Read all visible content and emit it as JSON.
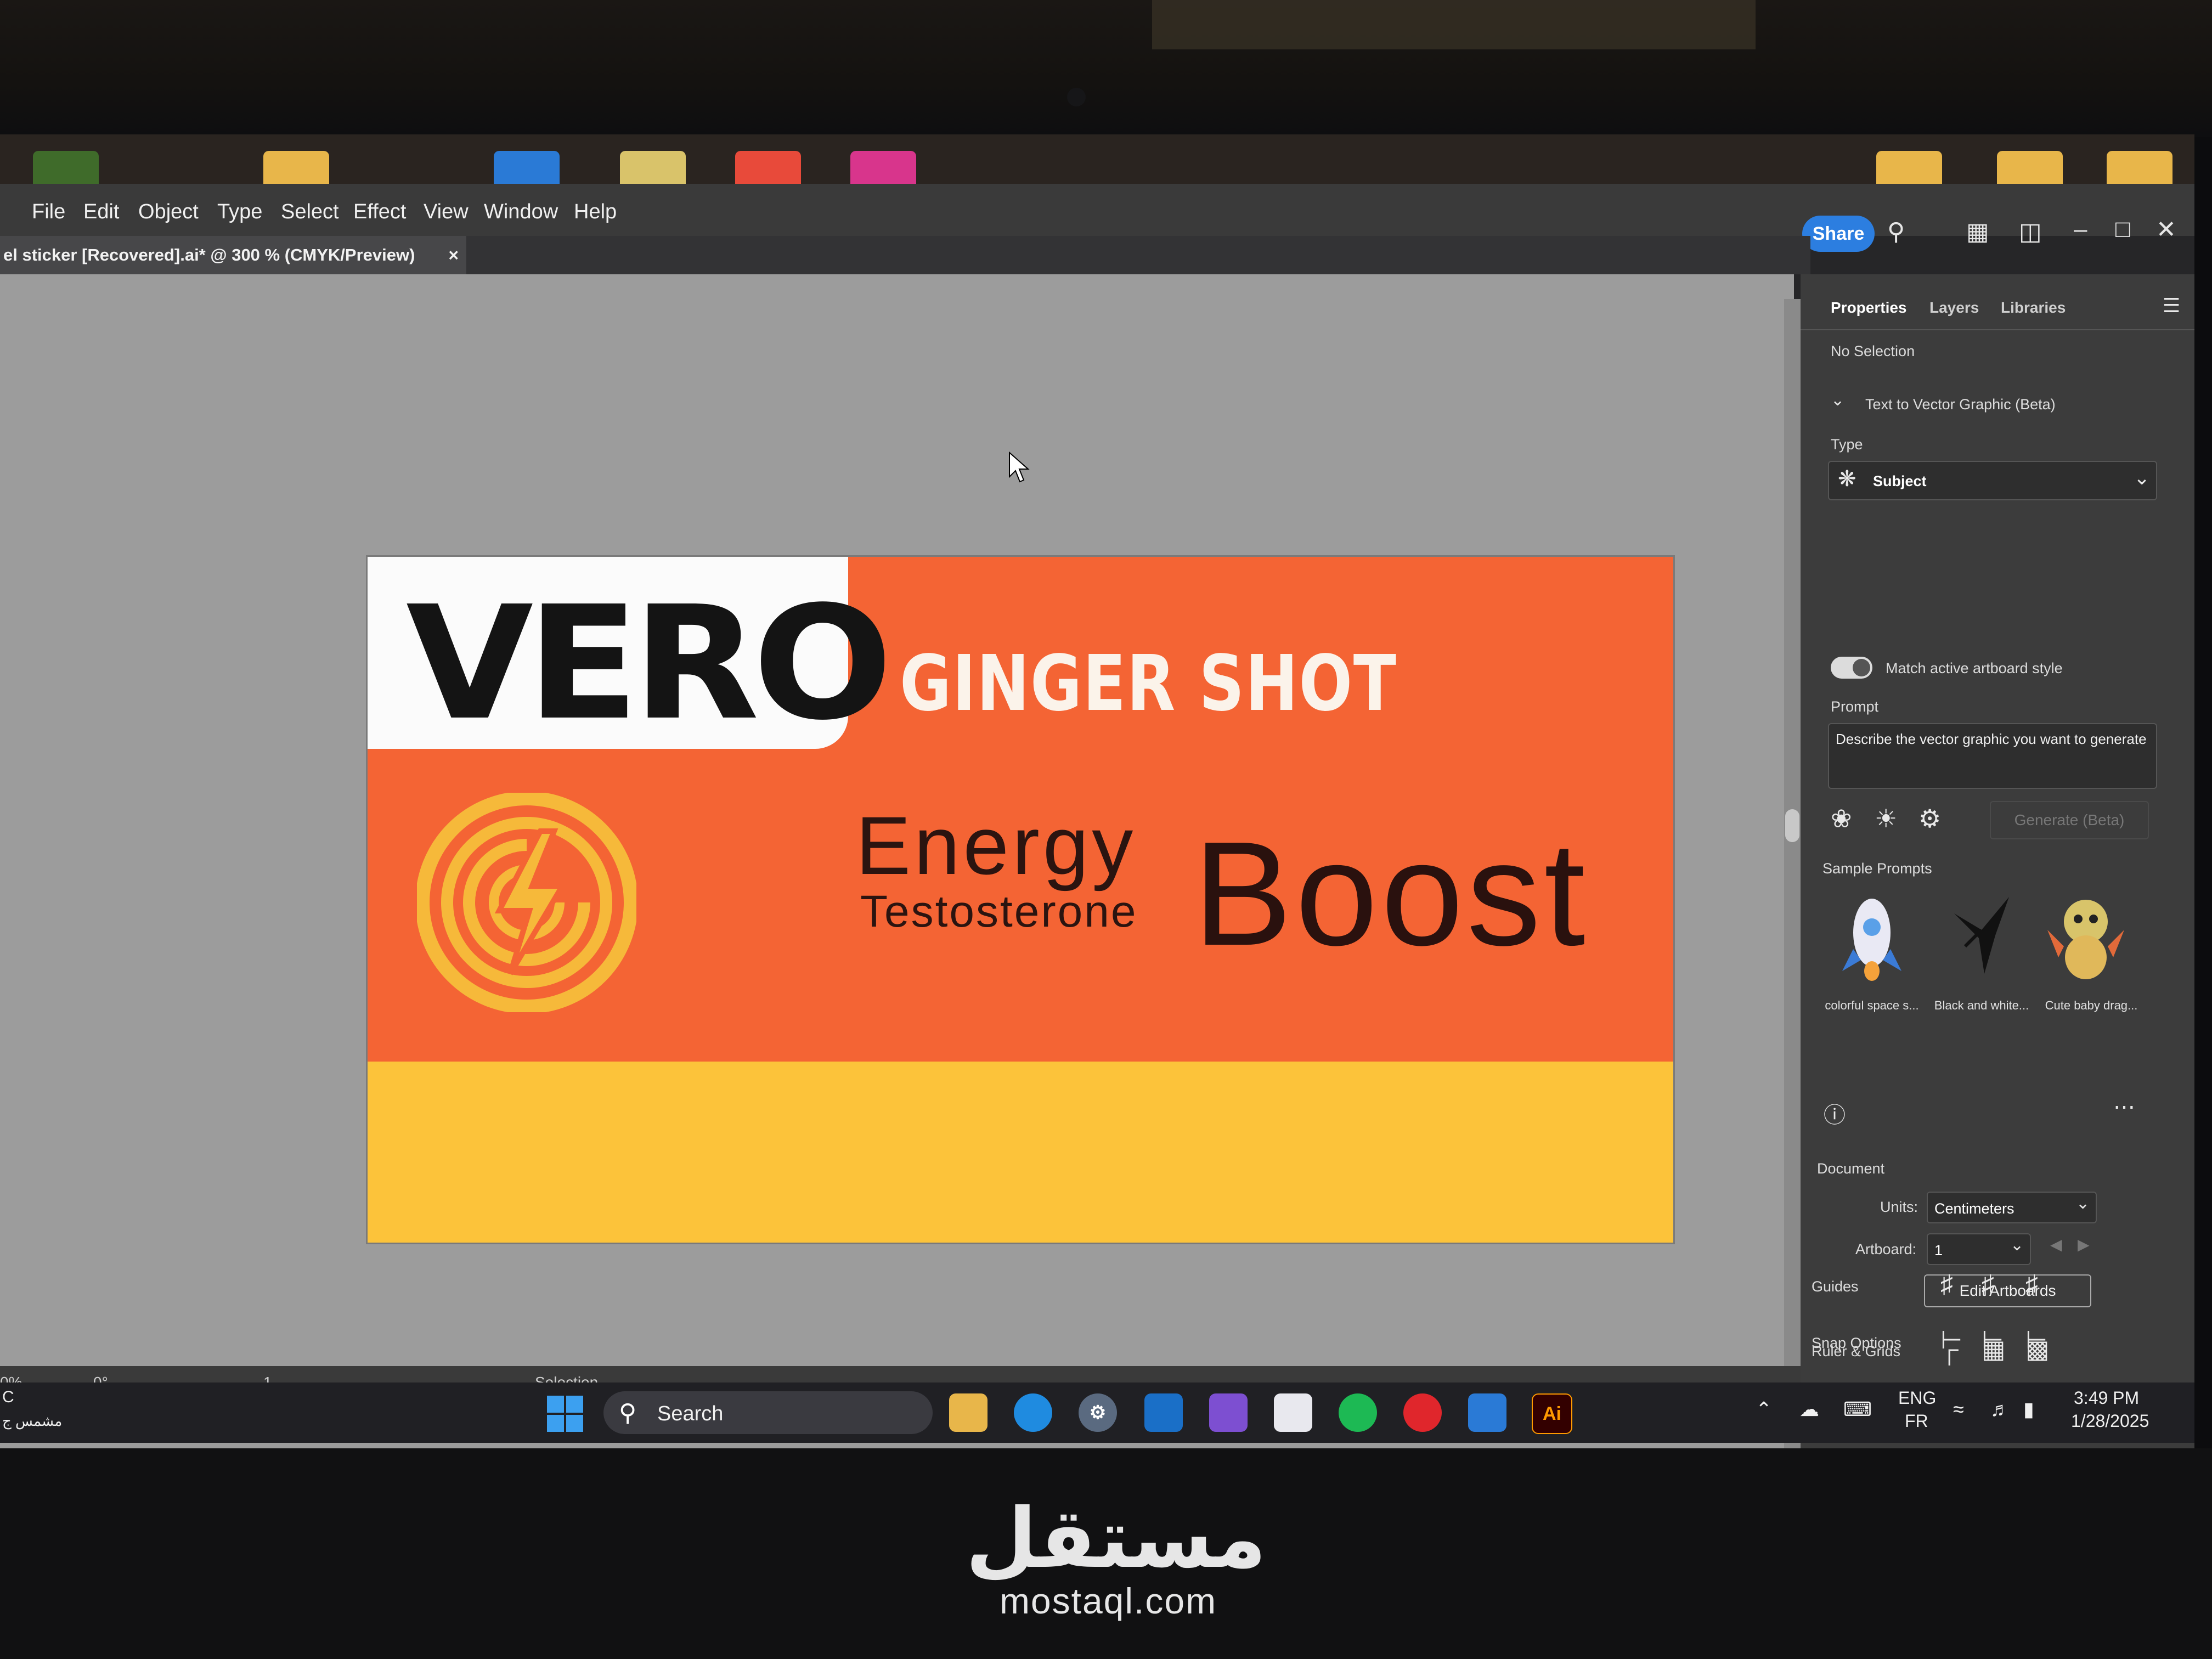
{
  "menubar": {
    "items": [
      "File",
      "Edit",
      "Object",
      "Type",
      "Select",
      "Effect",
      "View",
      "Window",
      "Help"
    ],
    "share_label": "Share"
  },
  "document_tab": {
    "title": "el sticker [Recovered].ai* @ 300 % (CMYK/Preview)",
    "close": "×"
  },
  "artboard": {
    "logo": "VERO",
    "headline": "GINGER SHOT",
    "line1": "Energy",
    "line2": "Testosterone",
    "big": "Boost",
    "colors": {
      "orange": "#f46434",
      "yellow": "#fcc33a",
      "emblem": "#f6b93a"
    }
  },
  "statusbar": {
    "zoom": "0%",
    "angle": "0°",
    "artboard_nav": "1",
    "tool": "Selection"
  },
  "panel": {
    "tabs": [
      "Properties",
      "Layers",
      "Libraries"
    ],
    "selection": "No Selection",
    "section_title": "Text to Vector Graphic (Beta)",
    "type_label": "Type",
    "type_value": "Subject",
    "match_label": "Match active artboard style",
    "prompt_label": "Prompt",
    "prompt_placeholder": "Describe the vector graphic you want to generate",
    "generate_label": "Generate (Beta)",
    "sample_prompts_label": "Sample Prompts",
    "samples": [
      "colorful space s...",
      "Black and white...",
      "Cute baby drag..."
    ],
    "document_label": "Document",
    "units_label": "Units:",
    "units_value": "Centimeters",
    "artboard_label": "Artboard:",
    "artboard_value": "1",
    "edit_artboards": "Edit Artboards",
    "ruler_grids": "Ruler & Grids",
    "guides": "Guides",
    "snap_options": "Snap Options"
  },
  "taskbar": {
    "search_label": "Search",
    "lang_top": "ENG",
    "lang_bottom": "FR",
    "time": "3:49 PM",
    "date": "1/28/2025",
    "left_temp": "C",
    "left_weather": "مشمس ج"
  },
  "watermark": {
    "arabic": "مستقل",
    "latin": "mostaql.com"
  }
}
